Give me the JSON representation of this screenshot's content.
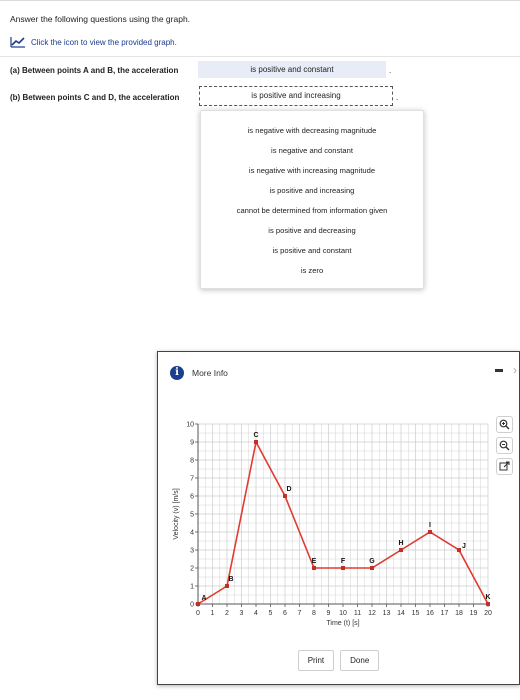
{
  "instructions": "Answer the following questions using the graph.",
  "graph_link": {
    "label": "Click the icon to view the provided graph.",
    "icon": "line-chart-icon"
  },
  "questions": [
    {
      "label": "(a) Between points A and B, the acceleration",
      "answer": "is positive and constant"
    },
    {
      "label": "(b) Between points C and D, the acceleration",
      "answer": "is positive and increasing"
    }
  ],
  "period": ".",
  "dropdown_options": [
    "is negative with decreasing magnitude",
    "is negative and constant",
    "is negative with increasing magnitude",
    "is positive and increasing",
    "cannot be determined from information given",
    "is positive and decreasing",
    "is positive and constant",
    "is zero"
  ],
  "dialog": {
    "title": "More Info",
    "print_label": "Print",
    "done_label": "Done",
    "chev": "›"
  },
  "colors": {
    "line": "#e03c31",
    "point": "#c0302a",
    "grid": "#cccccc",
    "link": "#1a3a8f",
    "info": "#1b3f8c"
  },
  "chart_data": {
    "type": "line",
    "xlabel": "Time (t) [s]",
    "ylabel": "Velocity (v) [m/s]",
    "xlim": [
      0,
      20
    ],
    "ylim": [
      0,
      10
    ],
    "xticks": [
      0,
      1,
      2,
      3,
      4,
      5,
      6,
      7,
      8,
      9,
      10,
      11,
      12,
      13,
      14,
      15,
      16,
      17,
      18,
      19,
      20
    ],
    "yticks": [
      0,
      1,
      2,
      3,
      4,
      5,
      6,
      7,
      8,
      9,
      10
    ],
    "grid": true,
    "points": [
      {
        "label": "A",
        "x": 0,
        "y": 0
      },
      {
        "label": "B",
        "x": 2,
        "y": 1
      },
      {
        "label": "C",
        "x": 4,
        "y": 9
      },
      {
        "label": "D",
        "x": 6,
        "y": 6
      },
      {
        "label": "E",
        "x": 8,
        "y": 2
      },
      {
        "label": "F",
        "x": 10,
        "y": 2
      },
      {
        "label": "G",
        "x": 12,
        "y": 2
      },
      {
        "label": "H",
        "x": 14,
        "y": 3
      },
      {
        "label": "I",
        "x": 16,
        "y": 4
      },
      {
        "label": "J",
        "x": 18,
        "y": 3
      },
      {
        "label": "K",
        "x": 20,
        "y": 0
      }
    ]
  }
}
